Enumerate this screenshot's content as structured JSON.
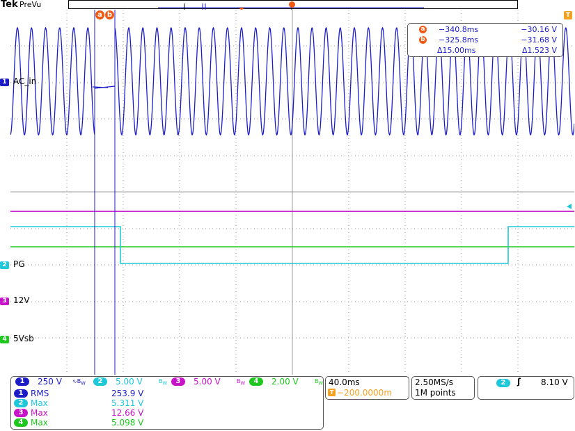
{
  "header": {
    "brand": "Tek",
    "mode": "PreVu"
  },
  "cursors": {
    "a_label": "a",
    "b_label": "b",
    "a_time": "−340.8ms",
    "a_value": "−30.16 V",
    "b_time": "−325.8ms",
    "b_value": "−31.68 V",
    "delta_time": "Δ15.00ms",
    "delta_value": "Δ1.523 V"
  },
  "channels": [
    {
      "num": "1",
      "label": "AC_in",
      "color": "#1c1cc8",
      "scale": "250 V"
    },
    {
      "num": "2",
      "label": "PG",
      "color": "#1ec8d8",
      "scale": "5.00 V"
    },
    {
      "num": "3",
      "label": "12V",
      "color": "#c814c8",
      "scale": "5.00 V"
    },
    {
      "num": "4",
      "label": "5Vsb",
      "color": "#1ec81e",
      "scale": "2.00 V"
    }
  ],
  "measurements": [
    {
      "ch": "1",
      "name": "RMS",
      "value": "253.9 V",
      "color": "#1c1cc8"
    },
    {
      "ch": "2",
      "name": "Max",
      "value": "5.311 V",
      "color": "#1ec8d8"
    },
    {
      "ch": "3",
      "name": "Max",
      "value": "12.66 V",
      "color": "#c814c8"
    },
    {
      "ch": "4",
      "name": "Max",
      "value": "5.098 V",
      "color": "#1ec81e"
    }
  ],
  "horizontal": {
    "time_div": "40.0ms",
    "position": "−200.0000m"
  },
  "acquisition": {
    "sample_rate": "2.50MS/s",
    "record_length": "1M points"
  },
  "trigger": {
    "source": "2",
    "slope_icon": "rising-edge-icon",
    "level": "8.10 V"
  },
  "colors": {
    "cursor_orange": "#f05a14",
    "graticule": "#9a9a9a"
  }
}
